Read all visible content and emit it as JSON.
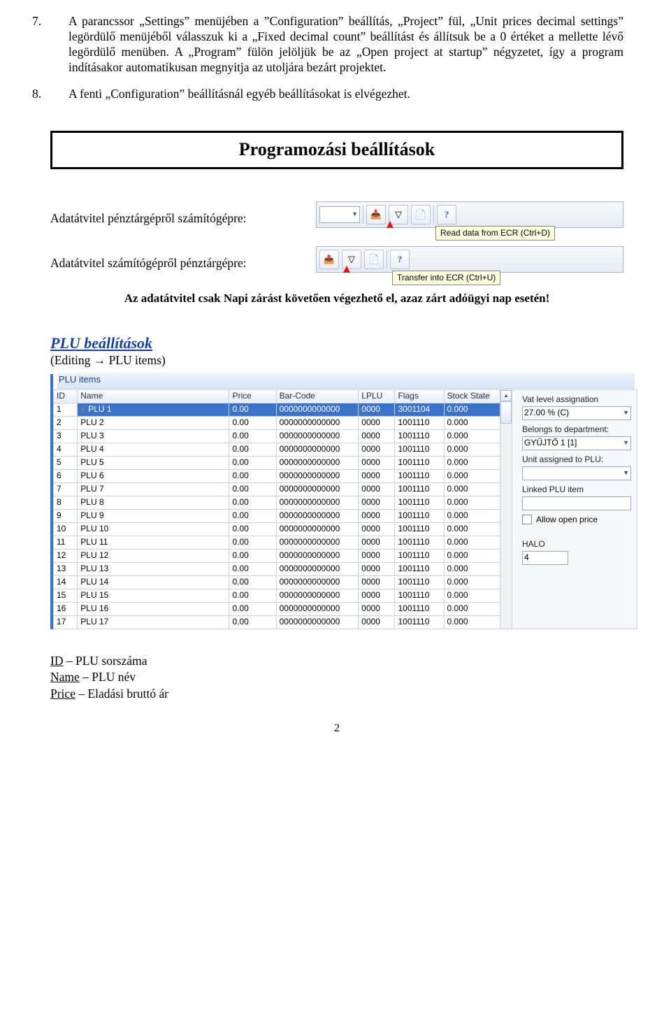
{
  "para7_num": "7.",
  "para7_text": "A parancssor „Settings” menüjében a ”Configuration” beállítás, „Project” fül, „Unit prices decimal settings” legördülő menüjéből válasszuk ki a „Fixed decimal count” beállítást és állítsuk be a 0 értéket a mellette lévő legördülő menüben. A „Program” fülön jelöljük be az „Open project at startup” négyzetet, így a program indításakor automatikusan megnyitja az utoljára bezárt projektet.",
  "para8_num": "8.",
  "para8_text": "A fenti „Configuration” beállításnál egyéb beállításokat is elvégezhet.",
  "section_title": "Programozási beállítások",
  "row1_label": "Adatátvitel pénztárgépről számítógépre:",
  "row2_label": "Adatátvitel számítógépről pénztárgépre:",
  "tooltip1": "Read data from ECR (Ctrl+D)",
  "tooltip2": "Transfer into ECR (Ctrl+U)",
  "note": "Az adatátvitel csak Napi zárást követően végezhető el, azaz zárt adóügyi nap esetén!",
  "plu_heading": "PLU beállítások",
  "plu_sub_prefix": "(Editing ",
  "plu_sub_arrow": "→",
  "plu_sub_suffix": " PLU items)",
  "plu_window_title": "PLU items",
  "columns": [
    "ID",
    "Name",
    "Price",
    "Bar-Code",
    "LPLU",
    "Flags",
    "Stock State"
  ],
  "rows": [
    {
      "id": "1",
      "name": "PLU 1",
      "price": "0.00",
      "bar": "0000000000000",
      "lplu": "0000",
      "flags": "3001104",
      "stock": "0.000",
      "sel": true,
      "hash": true
    },
    {
      "id": "2",
      "name": "PLU 2",
      "price": "0.00",
      "bar": "0000000000000",
      "lplu": "0000",
      "flags": "1001110",
      "stock": "0.000"
    },
    {
      "id": "3",
      "name": "PLU 3",
      "price": "0.00",
      "bar": "0000000000000",
      "lplu": "0000",
      "flags": "1001110",
      "stock": "0.000"
    },
    {
      "id": "4",
      "name": "PLU 4",
      "price": "0.00",
      "bar": "0000000000000",
      "lplu": "0000",
      "flags": "1001110",
      "stock": "0.000"
    },
    {
      "id": "5",
      "name": "PLU 5",
      "price": "0.00",
      "bar": "0000000000000",
      "lplu": "0000",
      "flags": "1001110",
      "stock": "0.000"
    },
    {
      "id": "6",
      "name": "PLU 6",
      "price": "0.00",
      "bar": "0000000000000",
      "lplu": "0000",
      "flags": "1001110",
      "stock": "0.000"
    },
    {
      "id": "7",
      "name": "PLU 7",
      "price": "0.00",
      "bar": "0000000000000",
      "lplu": "0000",
      "flags": "1001110",
      "stock": "0.000"
    },
    {
      "id": "8",
      "name": "PLU 8",
      "price": "0.00",
      "bar": "0000000000000",
      "lplu": "0000",
      "flags": "1001110",
      "stock": "0.000"
    },
    {
      "id": "9",
      "name": "PLU 9",
      "price": "0.00",
      "bar": "0000000000000",
      "lplu": "0000",
      "flags": "1001110",
      "stock": "0.000"
    },
    {
      "id": "10",
      "name": "PLU 10",
      "price": "0.00",
      "bar": "0000000000000",
      "lplu": "0000",
      "flags": "1001110",
      "stock": "0.000"
    },
    {
      "id": "11",
      "name": "PLU 11",
      "price": "0.00",
      "bar": "0000000000000",
      "lplu": "0000",
      "flags": "1001110",
      "stock": "0.000"
    },
    {
      "id": "12",
      "name": "PLU 12",
      "price": "0.00",
      "bar": "0000000000000",
      "lplu": "0000",
      "flags": "1001110",
      "stock": "0.000"
    },
    {
      "id": "13",
      "name": "PLU 13",
      "price": "0.00",
      "bar": "0000000000000",
      "lplu": "0000",
      "flags": "1001110",
      "stock": "0.000"
    },
    {
      "id": "14",
      "name": "PLU 14",
      "price": "0.00",
      "bar": "0000000000000",
      "lplu": "0000",
      "flags": "1001110",
      "stock": "0.000"
    },
    {
      "id": "15",
      "name": "PLU 15",
      "price": "0.00",
      "bar": "0000000000000",
      "lplu": "0000",
      "flags": "1001110",
      "stock": "0.000"
    },
    {
      "id": "16",
      "name": "PLU 16",
      "price": "0.00",
      "bar": "0000000000000",
      "lplu": "0000",
      "flags": "1001110",
      "stock": "0.000"
    },
    {
      "id": "17",
      "name": "PLU 17",
      "price": "0.00",
      "bar": "0000000000000",
      "lplu": "0000",
      "flags": "1001110",
      "stock": "0.000"
    }
  ],
  "side": {
    "vat_label": "Vat level assignation",
    "vat_value": "27.00 % (C)",
    "dept_label": "Belongs to department:",
    "dept_value": "GYŰJTŐ 1 [1]",
    "unit_label": "Unit assigned to PLU:",
    "unit_value": "",
    "linked_label": "Linked PLU item",
    "linked_value": "",
    "allow_open": "Allow open price",
    "halo_label": "HALO",
    "halo_value": "4"
  },
  "defs": {
    "id_t": "ID",
    "id_d": " – PLU sorszáma",
    "name_t": "Name",
    "name_d": " – PLU név",
    "price_t": "Price",
    "price_d": " – Eladási bruttó ár"
  },
  "page_num": "2"
}
